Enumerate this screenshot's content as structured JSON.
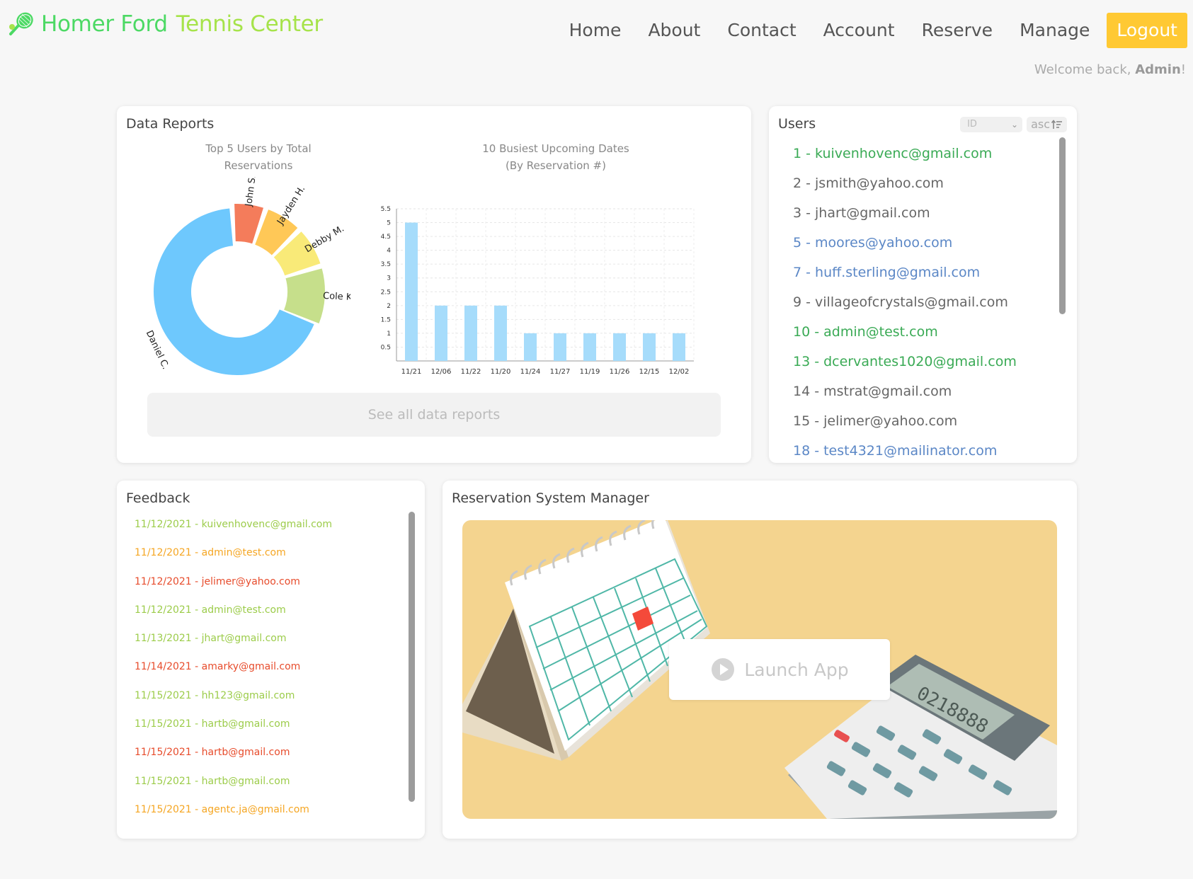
{
  "brand": {
    "name_part1": "Homer Ford",
    "name_part2": "Tennis Center",
    "color1": "#4cd964",
    "color2": "#a6e34a"
  },
  "nav": {
    "items": [
      "Home",
      "About",
      "Contact",
      "Account",
      "Reserve",
      "Manage"
    ],
    "logout_label": "Logout",
    "welcome_prefix": "Welcome back,",
    "welcome_user": "Admin",
    "welcome_suffix": "!"
  },
  "reports": {
    "title": "Data Reports",
    "donut_title_line1": "Top 5 Users by Total",
    "donut_title_line2": "Reservations",
    "bar_title_line1": "10 Busiest Upcoming Dates",
    "bar_title_line2": "(By Reservation #)",
    "see_all_label": "See all data reports"
  },
  "chart_data": [
    {
      "type": "pie",
      "variant": "donut",
      "title": "Top 5 Users by Total Reservations",
      "labels": [
        "Daniel C.",
        "John S.",
        "Jayden H.",
        "Debby M.",
        "Cole K."
      ],
      "values": [
        14,
        1.3,
        1.5,
        1.6,
        2.3
      ],
      "colors": [
        "#6ec8fd",
        "#f47c5b",
        "#ffc857",
        "#f9ea78",
        "#c6df8b"
      ]
    },
    {
      "type": "bar",
      "title": "10 Busiest Upcoming Dates (By Reservation #)",
      "categories": [
        "11/21",
        "12/06",
        "11/22",
        "11/20",
        "11/24",
        "11/27",
        "11/19",
        "11/26",
        "12/15",
        "12/02"
      ],
      "values": [
        5,
        2,
        2,
        2,
        1,
        1,
        1,
        1,
        1,
        1
      ],
      "ylim": [
        0,
        5.5
      ],
      "yticks": [
        "0.5",
        "1",
        "1.5",
        "2",
        "2.5",
        "3",
        "3.5",
        "4",
        "4.5",
        "5",
        "5.5"
      ],
      "grid": true,
      "bar_color": "#a6dcfb"
    }
  ],
  "users": {
    "title": "Users",
    "sort_field": "ID",
    "sort_dir": "asc",
    "items": [
      {
        "text": "1 - kuivenhovenc@gmail.com",
        "color": "#3aaa55"
      },
      {
        "text": "2 - jsmith@yahoo.com",
        "color": "#666666"
      },
      {
        "text": "3 - jhart@gmail.com",
        "color": "#666666"
      },
      {
        "text": "5 - moores@yahoo.com",
        "color": "#5b87c6"
      },
      {
        "text": "7 - huff.sterling@gmail.com",
        "color": "#5b87c6"
      },
      {
        "text": "9 - villageofcrystals@gmail.com",
        "color": "#666666"
      },
      {
        "text": "10 - admin@test.com",
        "color": "#3aaa55"
      },
      {
        "text": "13 - dcervantes1020@gmail.com",
        "color": "#3aaa55"
      },
      {
        "text": "14 - mstrat@gmail.com",
        "color": "#666666"
      },
      {
        "text": "15 - jelimer@yahoo.com",
        "color": "#666666"
      },
      {
        "text": "18 - test4321@mailinator.com",
        "color": "#5b87c6"
      }
    ]
  },
  "feedback": {
    "title": "Feedback",
    "items": [
      {
        "text": "11/12/2021 - kuivenhovenc@gmail.com",
        "color": "#9ccc4a"
      },
      {
        "text": "11/12/2021 - admin@test.com",
        "color": "#f5a623"
      },
      {
        "text": "11/12/2021 - jelimer@yahoo.com",
        "color": "#e74c2c"
      },
      {
        "text": "11/12/2021 - admin@test.com",
        "color": "#9ccc4a"
      },
      {
        "text": "11/13/2021 - jhart@gmail.com",
        "color": "#9ccc4a"
      },
      {
        "text": "11/14/2021 - amarky@gmail.com",
        "color": "#e74c2c"
      },
      {
        "text": "11/15/2021 - hh123@gmail.com",
        "color": "#9ccc4a"
      },
      {
        "text": "11/15/2021 - hartb@gmail.com",
        "color": "#9ccc4a"
      },
      {
        "text": "11/15/2021 - hartb@gmail.com",
        "color": "#e74c2c"
      },
      {
        "text": "11/15/2021 - hartb@gmail.com",
        "color": "#9ccc4a"
      },
      {
        "text": "11/15/2021 - agentc.ja@gmail.com",
        "color": "#f5a623"
      }
    ]
  },
  "manager": {
    "title": "Reservation System Manager",
    "launch_label": "Launch App",
    "calculator_display": "0218888"
  }
}
